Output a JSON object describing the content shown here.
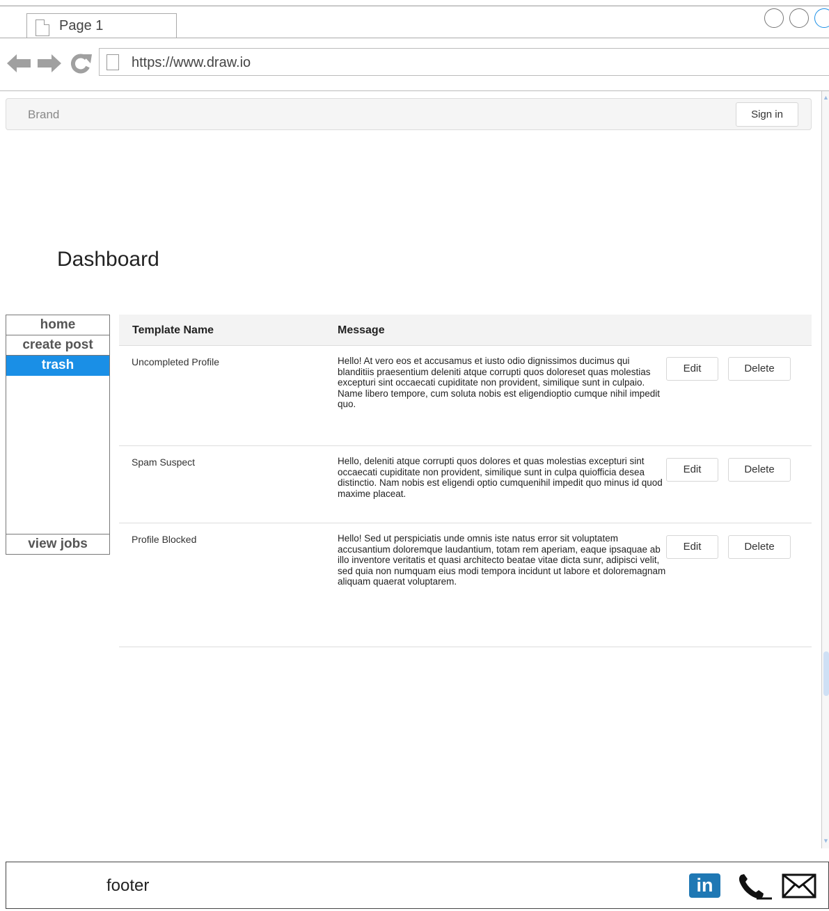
{
  "browser": {
    "tab_title": "Page 1",
    "url": "https://www.draw.io",
    "icons": [
      "page-icon",
      "back-arrow-icon",
      "forward-arrow-icon",
      "reload-icon"
    ]
  },
  "navbar": {
    "brand": "Brand",
    "signin_label": "Sign in"
  },
  "page_title": "Dashboard",
  "sidebar": {
    "items": [
      {
        "label": "home",
        "active": false
      },
      {
        "label": "create post",
        "active": false
      },
      {
        "label": "trash",
        "active": true
      }
    ],
    "bottom_item": "view jobs"
  },
  "table": {
    "columns": [
      "Template Name",
      "Message"
    ],
    "rows": [
      {
        "name": "Uncompleted Profile",
        "message": "Hello! At vero eos et accusamus et iusto odio dignissimos ducimus qui blanditiis praesentium deleniti atque corrupti quos doloreset quas molestias excepturi sint occaecati cupiditate non provident, similique sunt in culpaio. Name libero tempore, cum soluta nobis est eligendioptio cumque nihil impedit quo.",
        "edit_label": "Edit",
        "delete_label": "Delete"
      },
      {
        "name": "Spam Suspect",
        "message": "Hello, deleniti atque corrupti quos dolores et quas molestias excepturi sint occaecati cupiditate non provident, similique sunt in culpa quiofficia desea distinctio. Nam nobis est eligendi optio cumquenihil impedit quo minus id quod maxime placeat.",
        "edit_label": "Edit",
        "delete_label": "Delete"
      },
      {
        "name": "Profile Blocked",
        "message": "Hello! Sed ut perspiciatis unde omnis iste natus error sit voluptatem accusantium doloremque laudantium, totam rem aperiam, eaque ipsaquae ab illo inventore veritatis et quasi architecto beatae vitae dicta sunr, adipisci velit, sed quia non numquam eius modi tempora incidunt ut labore et doloremagnam aliquam quaerat voluptarem.",
        "edit_label": "Edit",
        "delete_label": "Delete"
      }
    ]
  },
  "footer": {
    "text": "footer",
    "linkedin_label": "in",
    "icons": [
      "linkedin-icon",
      "phone-icon",
      "mail-icon"
    ]
  },
  "colors": {
    "active_sidebar": "#1a8fe6",
    "linkedin": "#1f78b4"
  }
}
